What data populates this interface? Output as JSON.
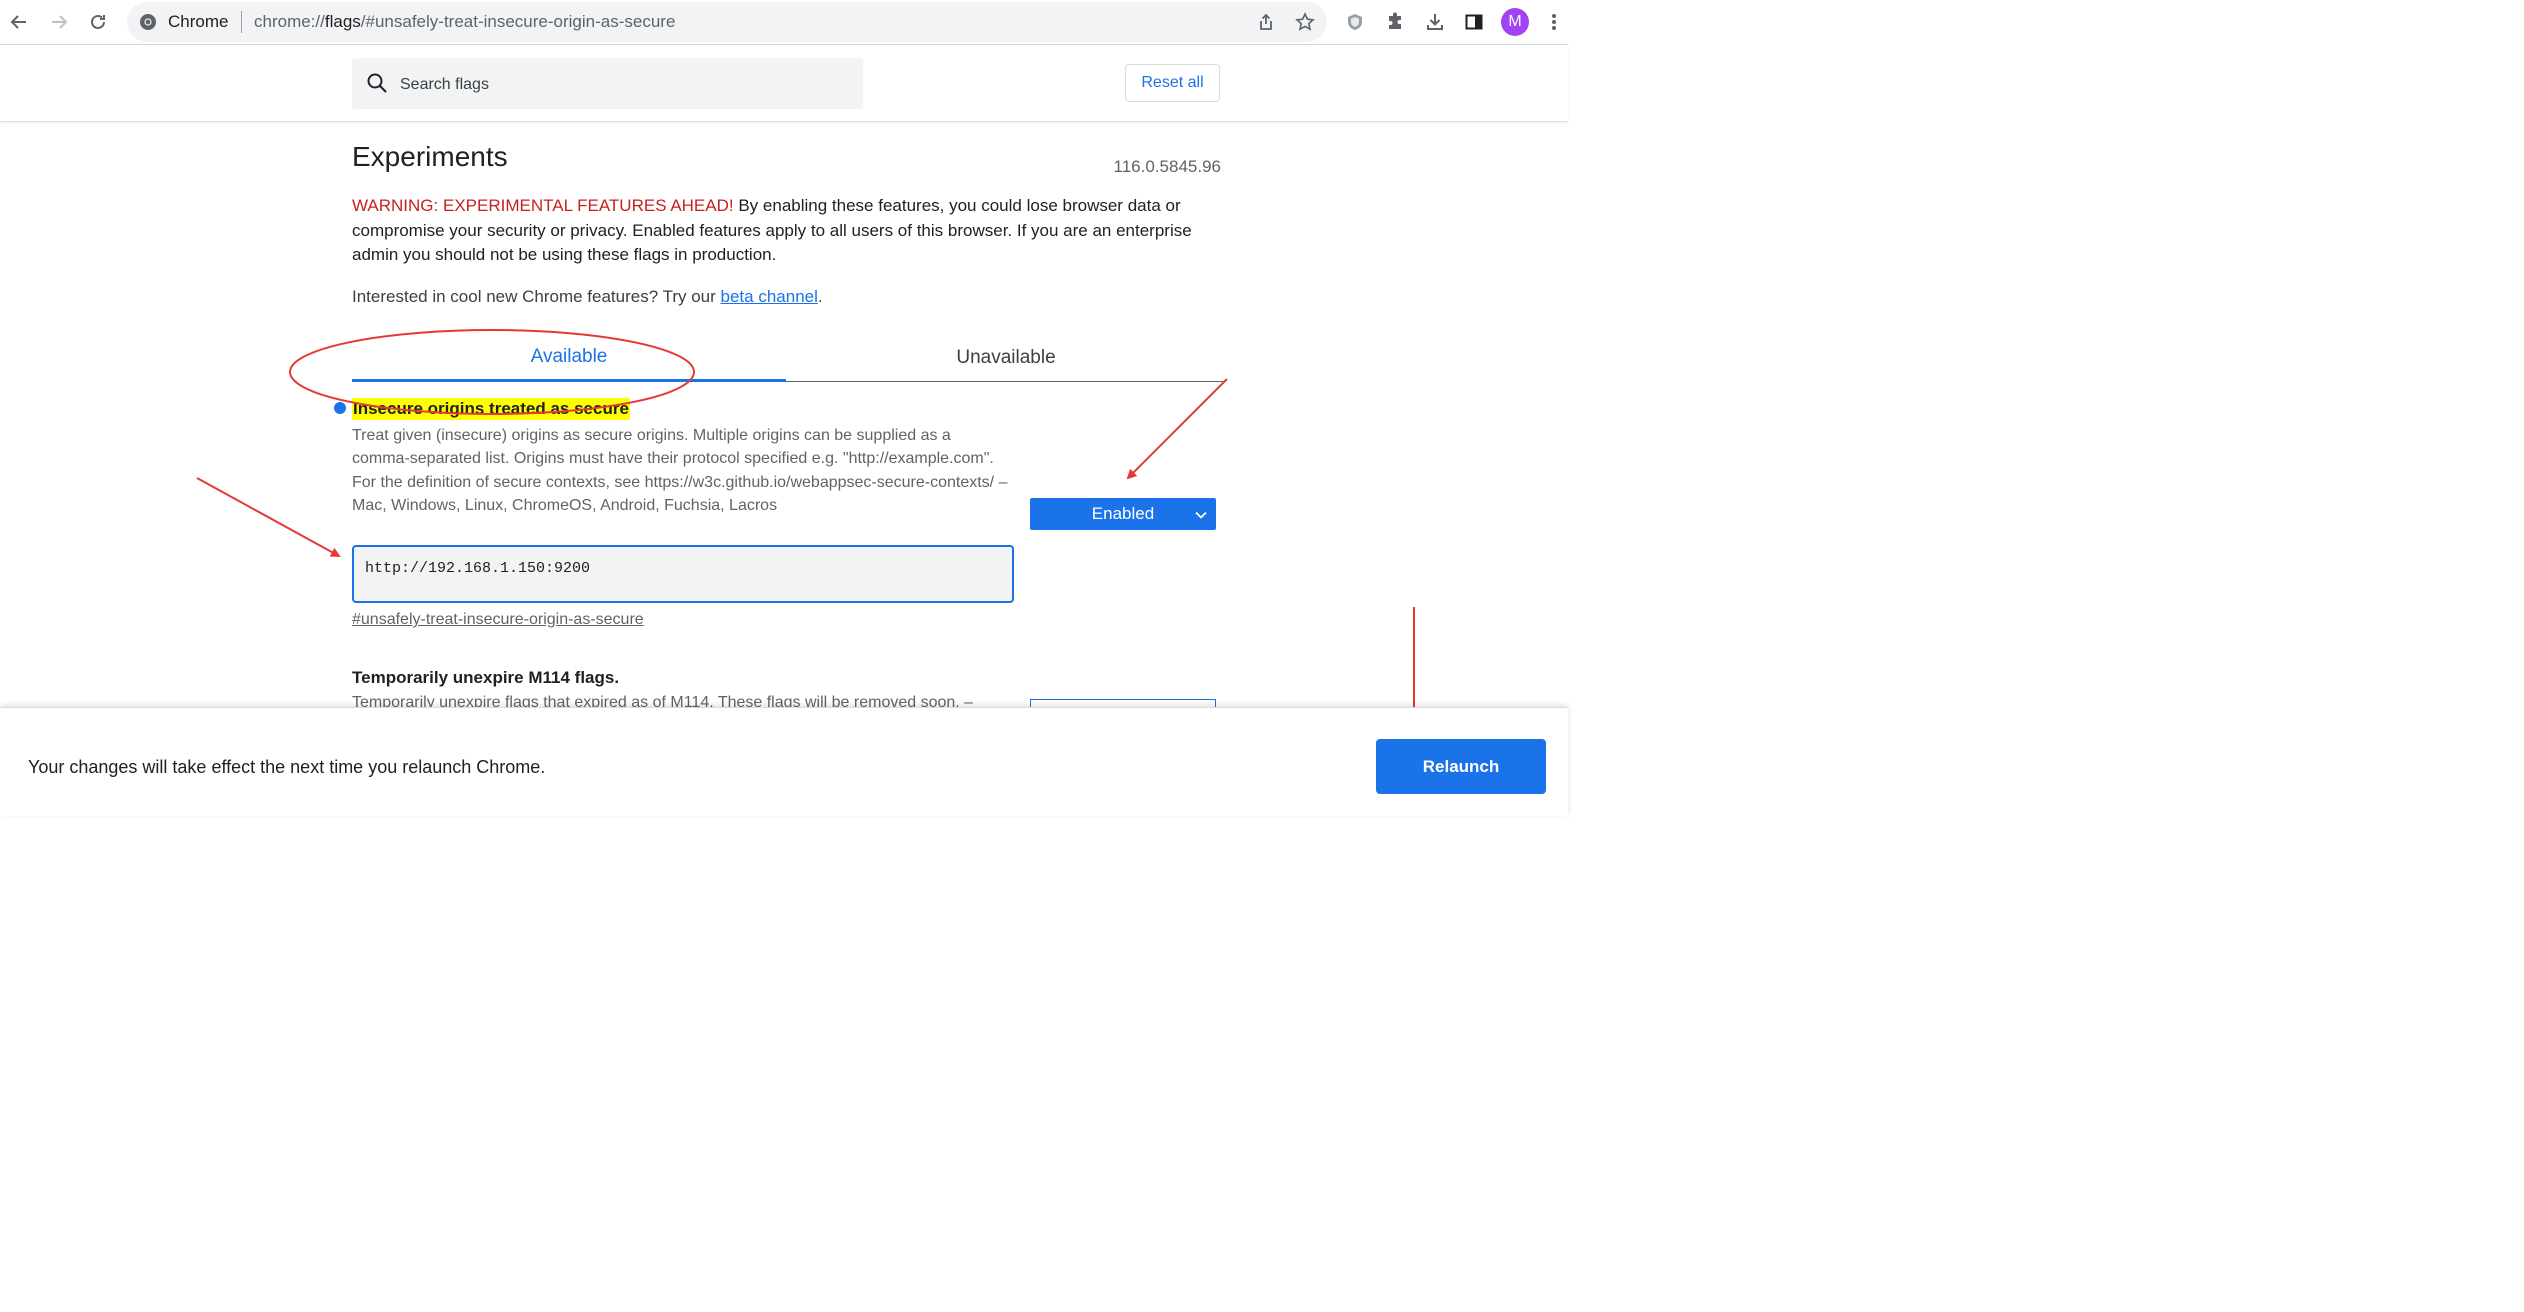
{
  "browser": {
    "chip_label": "Chrome",
    "url_prefix": "chrome://",
    "url_host": "flags",
    "url_rest": "/#unsafely-treat-insecure-origin-as-secure",
    "avatar_letter": "M"
  },
  "header": {
    "search_placeholder": "Search flags",
    "reset_label": "Reset all"
  },
  "main": {
    "title": "Experiments",
    "version": "116.0.5845.96",
    "warning_prefix": "WARNING: EXPERIMENTAL FEATURES AHEAD!",
    "warning_body": " By enabling these features, you could lose browser data or compromise your security or privacy. Enabled features apply to all users of this browser. If you are an enterprise admin you should not be using these flags in production.",
    "beta_text": "Interested in cool new Chrome features? Try our ",
    "beta_link": "beta channel",
    "beta_suffix": ".",
    "tabs": [
      {
        "label": "Available",
        "active": true
      },
      {
        "label": "Unavailable",
        "active": false
      }
    ]
  },
  "flags": [
    {
      "name": "Insecure origins treated as secure",
      "description": "Treat given (insecure) origins as secure origins. Multiple origins can be supplied as a comma-separated list. Origins must have their protocol specified e.g. \"http://example.com\". For the definition of secure contexts, see https://w3c.github.io/webappsec-secure-contexts/ – Mac, Windows, Linux, ChromeOS, Android, Fuchsia, Lacros",
      "origin_value": "http://192.168.1.150:9200",
      "link": "#unsafely-treat-insecure-origin-as-secure",
      "state": "Enabled"
    },
    {
      "name": "Temporarily unexpire M114 flags.",
      "description": "Temporarily unexpire flags that expired as of M114. These flags will be removed soon. –"
    }
  ],
  "relaunch": {
    "message": "Your changes will take effect the next time you relaunch Chrome.",
    "button_label": "Relaunch"
  },
  "colors": {
    "accent": "#1a73e8",
    "warning": "#c5221f",
    "highlight": "#ffff00",
    "annotation": "#e53935"
  },
  "icons": [
    "back-icon",
    "forward-icon",
    "reload-icon",
    "chrome-icon",
    "share-icon",
    "star-icon",
    "shield-extension-icon",
    "puzzle-icon",
    "download-icon",
    "side-panel-icon",
    "more-icon",
    "search-icon",
    "chevron-down-icon"
  ]
}
